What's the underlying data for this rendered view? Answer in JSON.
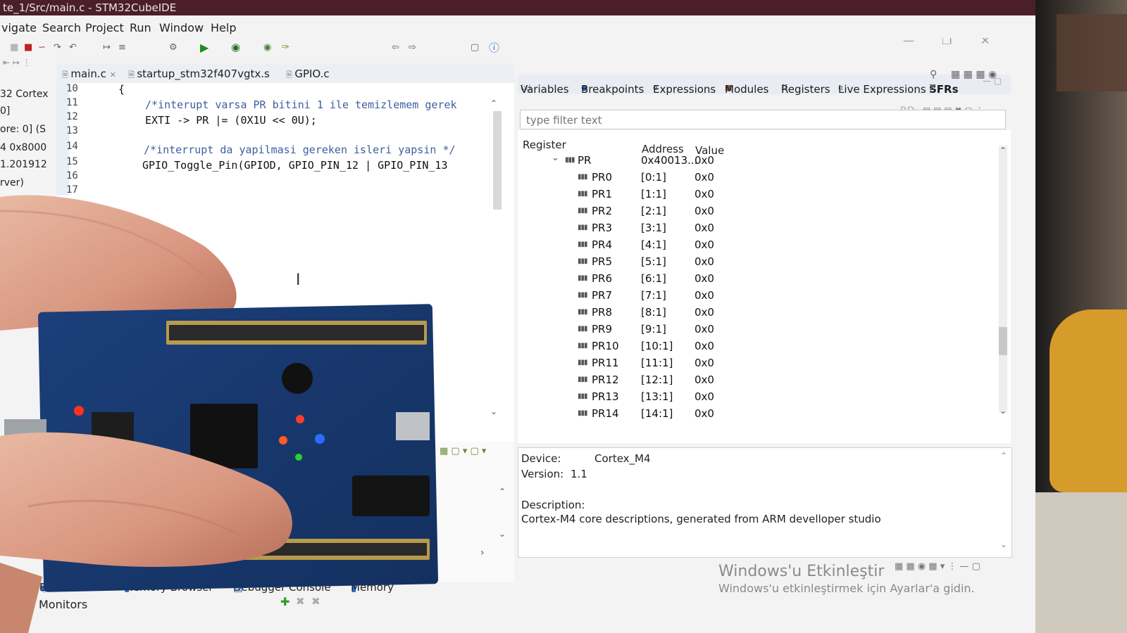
{
  "window": {
    "title": "te_1/Src/main.c - STM32CubeIDE"
  },
  "menu": {
    "items": [
      "vigate",
      "Search",
      "Project",
      "Run",
      "Window",
      "Help"
    ]
  },
  "left_strip": {
    "lines": [
      "32 Cortex",
      "0]",
      "ore: 0] (S",
      "4 0x8000",
      "1.201912",
      "rver)"
    ]
  },
  "editor": {
    "tabs": [
      "main.c",
      "startup_stm32f407vgtx.s",
      "GPIO.c"
    ],
    "line_numbers": [
      "10",
      "11",
      "12",
      "13",
      "14",
      "15",
      "16",
      "17"
    ],
    "code_lines": [
      "{",
      "/*interupt varsa PR bitini 1 ile temizlemem gerek",
      "EXTI -> PR |= (0X1U << 0U);",
      "",
      "/*interrupt da yapilmasi gereken isleri yapsin */",
      "GPIO_Toggle_Pin(GPIOD, GPIO_PIN_12 | GPIO_PIN_13",
      "",
      ""
    ]
  },
  "debug_panel": {
    "tabs": [
      "Variables",
      "Breakpoints",
      "Expressions",
      "Modules",
      "Registers",
      "Live Expressions",
      "SFRs"
    ],
    "filter_placeholder": "type filter text",
    "toolbar_label": "RD",
    "columns": [
      "Register",
      "Address",
      "Value"
    ],
    "parent": {
      "name": "PR",
      "address": "0x40013...",
      "value": "0x0"
    },
    "rows": [
      {
        "name": "PR0",
        "address": "[0:1]",
        "value": "0x0"
      },
      {
        "name": "PR1",
        "address": "[1:1]",
        "value": "0x0"
      },
      {
        "name": "PR2",
        "address": "[2:1]",
        "value": "0x0"
      },
      {
        "name": "PR3",
        "address": "[3:1]",
        "value": "0x0"
      },
      {
        "name": "PR4",
        "address": "[4:1]",
        "value": "0x0"
      },
      {
        "name": "PR5",
        "address": "[5:1]",
        "value": "0x0"
      },
      {
        "name": "PR6",
        "address": "[6:1]",
        "value": "0x0"
      },
      {
        "name": "PR7",
        "address": "[7:1]",
        "value": "0x0"
      },
      {
        "name": "PR8",
        "address": "[8:1]",
        "value": "0x0"
      },
      {
        "name": "PR9",
        "address": "[9:1]",
        "value": "0x0"
      },
      {
        "name": "PR10",
        "address": "[10:1]",
        "value": "0x0"
      },
      {
        "name": "PR11",
        "address": "[11:1]",
        "value": "0x0"
      },
      {
        "name": "PR12",
        "address": "[12:1]",
        "value": "0x0"
      },
      {
        "name": "PR13",
        "address": "[13:1]",
        "value": "0x0"
      },
      {
        "name": "PR14",
        "address": "[14:1]",
        "value": "0x0"
      }
    ],
    "info": {
      "device_label": "Device:",
      "device_value": "Cortex_M4",
      "version_label": "Version:",
      "version_value": "1.1",
      "description_label": "Description:",
      "description_value": "Cortex-M4 core descriptions, generated from ARM develloper studio"
    }
  },
  "bottom_tabs": [
    "Executables",
    "Memory Browser",
    "Debugger Console",
    "Memory"
  ],
  "monitors_label": "Monitors",
  "activation": {
    "title": "Windows'u Etkinleştir",
    "subtitle": "Windows'u etkinleştirmek için Ayarlar'a gidin."
  }
}
